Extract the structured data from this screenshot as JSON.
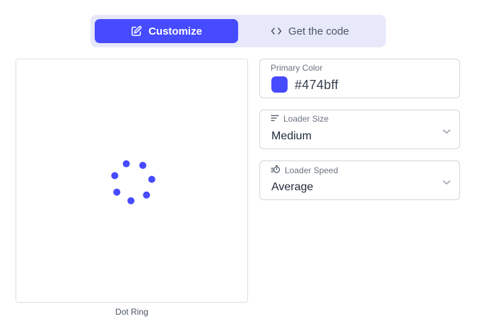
{
  "tabs": {
    "customize_label": "Customize",
    "code_label": "Get the code",
    "customize_icon": "edit-icon",
    "code_icon": "code-brackets-icon"
  },
  "preview": {
    "caption": "Dot Ring",
    "dot_count": 7,
    "dot_color": "#474bff"
  },
  "settings": {
    "primary_color": {
      "label": "Primary Color",
      "value": "#474bff"
    },
    "loader_size": {
      "label": "Loader Size",
      "value": "Medium",
      "icon": "lines-icon"
    },
    "loader_speed": {
      "label": "Loader Speed",
      "value": "Average",
      "icon": "stopwatch-icon"
    }
  },
  "colors": {
    "accent": "#474bff",
    "tab_background": "#e7e9fb"
  }
}
